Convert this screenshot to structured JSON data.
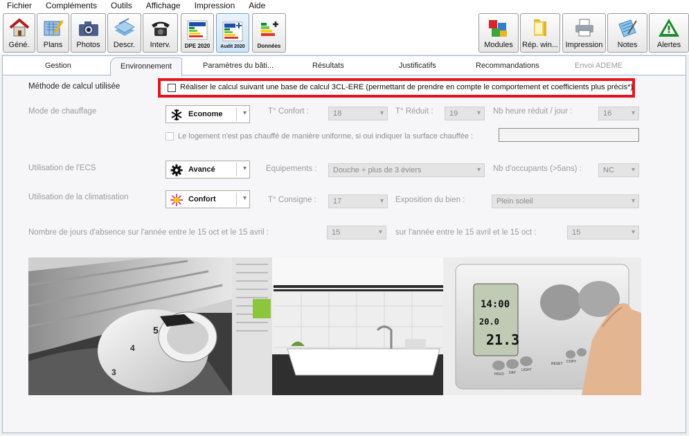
{
  "menu": [
    "Fichier",
    "Compléments",
    "Outils",
    "Affichage",
    "Impression",
    "Aide"
  ],
  "toolbar_left": [
    {
      "label": "Géné.",
      "icon": "house-icon"
    },
    {
      "label": "Plans",
      "icon": "plan-ruler-icon"
    },
    {
      "label": "Photos",
      "icon": "camera-icon"
    },
    {
      "label": "Descr.",
      "icon": "layers-icon"
    },
    {
      "label": "Interv.",
      "icon": "telephone-icon"
    },
    {
      "label": "DPE 2020",
      "icon": "energy-label-eu-icon"
    },
    {
      "label": "Audit 2020",
      "icon": "energy-label-plus-icon"
    },
    {
      "label": "Données",
      "icon": "energy-label-data-icon"
    }
  ],
  "toolbar_right": [
    {
      "label": "Modules",
      "icon": "puzzle-icon"
    },
    {
      "label": "Rép. win...",
      "icon": "folder-icon"
    },
    {
      "label": "Impression",
      "icon": "printer-icon"
    },
    {
      "label": "Notes",
      "icon": "notes-icon"
    },
    {
      "label": "Alertes",
      "icon": "warning-triangle-icon"
    }
  ],
  "tabs": [
    "Gestion",
    "Environnement",
    "Paramètres du bâti...",
    "Résultats",
    "Justificatifs",
    "Recommandations",
    "Envoi ADEME"
  ],
  "active_tab": "Environnement",
  "method": {
    "label": "Méthode de calcul utilisée",
    "checkbox_text": "Réaliser le calcul suivant une base de calcul 3CL-ERE (permettant de prendre en compte le comportement et coefficients plus précis*)",
    "checked": false
  },
  "heating": {
    "label": "Mode de chauffage",
    "mode": "Econome",
    "t_confort_label": "T° Confort :",
    "t_confort": "18",
    "t_reduit_label": "T° Réduit :",
    "t_reduit": "19",
    "nb_heure_label": "Nb heure réduit / jour :",
    "nb_heure": "16",
    "non_uniform_text": "Le logement n'est pas chauffé de manière uniforme, si oui indiquer la surface chauffée :",
    "surface": ""
  },
  "ecs": {
    "label": "Utilisation de l'ECS",
    "mode": "Avancé",
    "equipements_label": "Equipements :",
    "equipements": "Douche + plus de 3 éviers",
    "occupants_label": "Nb d'occupants (>5ans) :",
    "occupants": "NC"
  },
  "clim": {
    "label": "Utilisation de la climatisation",
    "mode": "Confort",
    "t_consigne_label": "T° Consigne :",
    "t_consigne": "17",
    "exposition_label": "Exposition  du  bien :",
    "exposition": "Plein soleil"
  },
  "absence": {
    "label1": "Nombre de jours d'absence sur l'année entre le 15 oct et le 15 avril :",
    "value1": "15",
    "label2": "sur l'année entre le 15 avril et le 15 oct :",
    "value2": "15"
  },
  "thermostat": {
    "line1": "14:00",
    "line2": "20.0",
    "line3": "21.3"
  },
  "thermostat_buttons": [
    "HOLD",
    "DAY",
    "LIGHT",
    "RESET",
    "COPY"
  ],
  "colors": {
    "highlight": "#e8141d",
    "panel_border": "#9fb6cf"
  }
}
